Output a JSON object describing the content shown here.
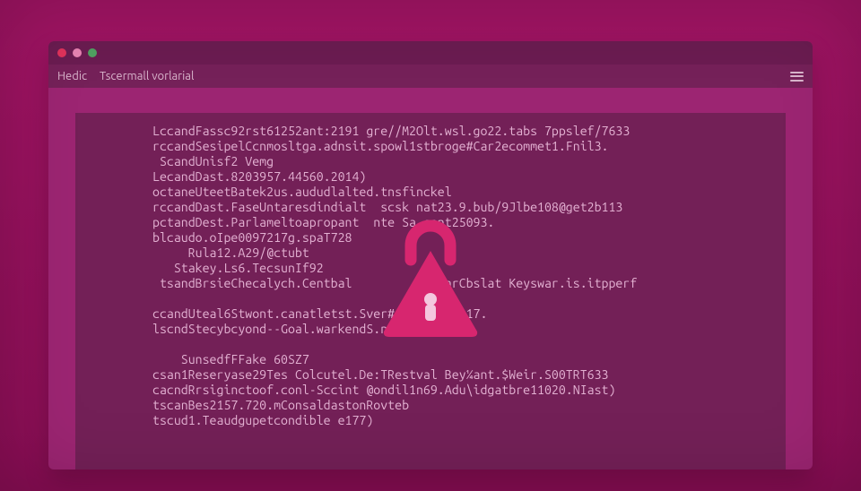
{
  "menubar": {
    "items": [
      "Hedic",
      "Tscermall vorlarial"
    ]
  },
  "terminal": {
    "lines": [
      "LccandFassc92rst61252ant:2191 gre//M2Olt.wsl.go22.tabs 7ppslef/7633",
      "rccandSesipelCcnmosltga.adnsit.spowl1stbroge#Car2ecommet1.Fnil3.",
      " ScandUnisf2 Vemg",
      "LecandDast.8203957.44560.2014)",
      "octaneUteetBatek2us.aududlalted.tnsfinckel",
      "rccandDast.FaseUntaresdindialt  scsk nat23.9.bub/9Jlbe108@get2b113",
      "pctandDest.Parlameltoapropant  nte Sa cant25093.",
      "blcaudo.oIpe0097217g.spaT728",
      "     Rula12.A29/@ctubt",
      "   Stakey.Ls6.TecsunIf92",
      " tsandBrsieChecalych.Centbal            farCbslat Keyswar.is.itpperf",
      "",
      "ccandUteal6Stwont.canatletst.Sver#445.20107217.",
      "lscndStecybcyond--Goal.warkendS.no1",
      "",
      "    SunsedfFFake 60SZ7",
      "csan1Reseryase29Tes Colcutel.De:TRestval Bey¼ant.$Weir.S00TRT633",
      "cacndRrsiginctoof.conl-Sccint @ondil1n69.Adu\\idgatbre11020.NIast)",
      "tscanBes2157.720.mConsaldastonRovteb",
      "tscud1.Teaudgupetcondible e177)"
    ]
  },
  "colors": {
    "bg_outer": "#a11464",
    "window_bg": "#9c2572",
    "terminal_bg": "#732057",
    "text": "#e3b1d2",
    "lock": "#d7266f"
  },
  "icons": {
    "lock": "lock-icon",
    "menu": "hamburger-icon"
  }
}
